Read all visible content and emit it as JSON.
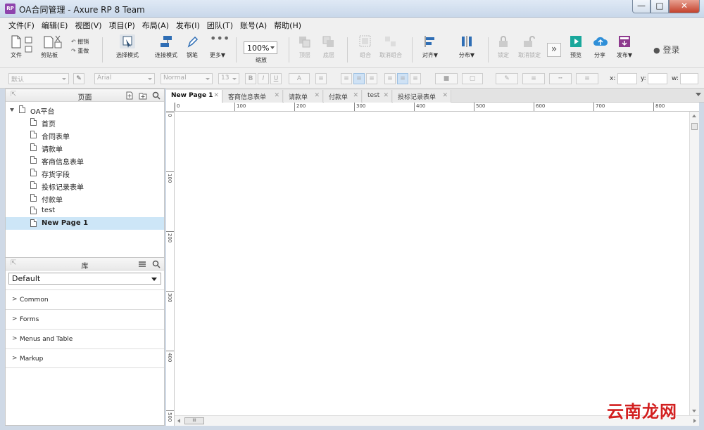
{
  "window": {
    "title": "OA合同管理 - Axure RP 8 Team",
    "app_icon_text": "RP",
    "close_glyph": "✕",
    "min_glyph": "—",
    "max_glyph": "□"
  },
  "menu": [
    "文件(F)",
    "编辑(E)",
    "视图(V)",
    "项目(P)",
    "布局(A)",
    "发布(I)",
    "团队(T)",
    "账号(A)",
    "帮助(H)"
  ],
  "toolbar": {
    "file": "文件",
    "clipboard": "剪贴板",
    "undo": "撤销",
    "redo": "重做",
    "select_mode": "选择模式",
    "connect_mode": "连接模式",
    "pen": "钢笔",
    "more": "更多▼",
    "zoom_value": "100%",
    "zoom_label": "缩放",
    "top": "顶层",
    "bottom": "底层",
    "group": "组合",
    "ungroup": "取消组合",
    "align": "对齐▼",
    "distribute": "分布▼",
    "lock": "锁定",
    "unlock": "取消锁定",
    "preview": "预览",
    "share": "分享",
    "publish": "发布▼",
    "login": "登录",
    "expand": "»"
  },
  "format": {
    "style": "默认",
    "font": "Arial",
    "weight": "Normal",
    "size": "13",
    "x_label": "x:",
    "y_label": "y:",
    "w_label": "w:"
  },
  "pages_panel": {
    "title": "页面",
    "root": "OA平台",
    "pages": [
      "首页",
      "合同表单",
      "请款单",
      "客商信息表单",
      "存货字段",
      "投标记录表单",
      "付款单",
      "test",
      "New Page 1"
    ]
  },
  "library_panel": {
    "title": "库",
    "selected": "Default",
    "groups": [
      "Common",
      "Forms",
      "Menus and Table",
      "Markup"
    ]
  },
  "tabs": [
    {
      "label": "New Page 1",
      "close": "✕"
    },
    {
      "label": "客商信息表单",
      "close": "✕"
    },
    {
      "label": "请款单",
      "close": "✕"
    },
    {
      "label": "付款单",
      "close": "✕"
    },
    {
      "label": "test",
      "close": "✕"
    },
    {
      "label": "投标记录表单",
      "close": "✕"
    }
  ],
  "ruler_h": [
    "0",
    "100",
    "200",
    "300",
    "400",
    "500",
    "600",
    "700",
    "800"
  ],
  "ruler_v": [
    "0",
    "100",
    "200",
    "300",
    "400",
    "500"
  ],
  "hscroll_thumb": "III",
  "watermark": "云南龙网"
}
